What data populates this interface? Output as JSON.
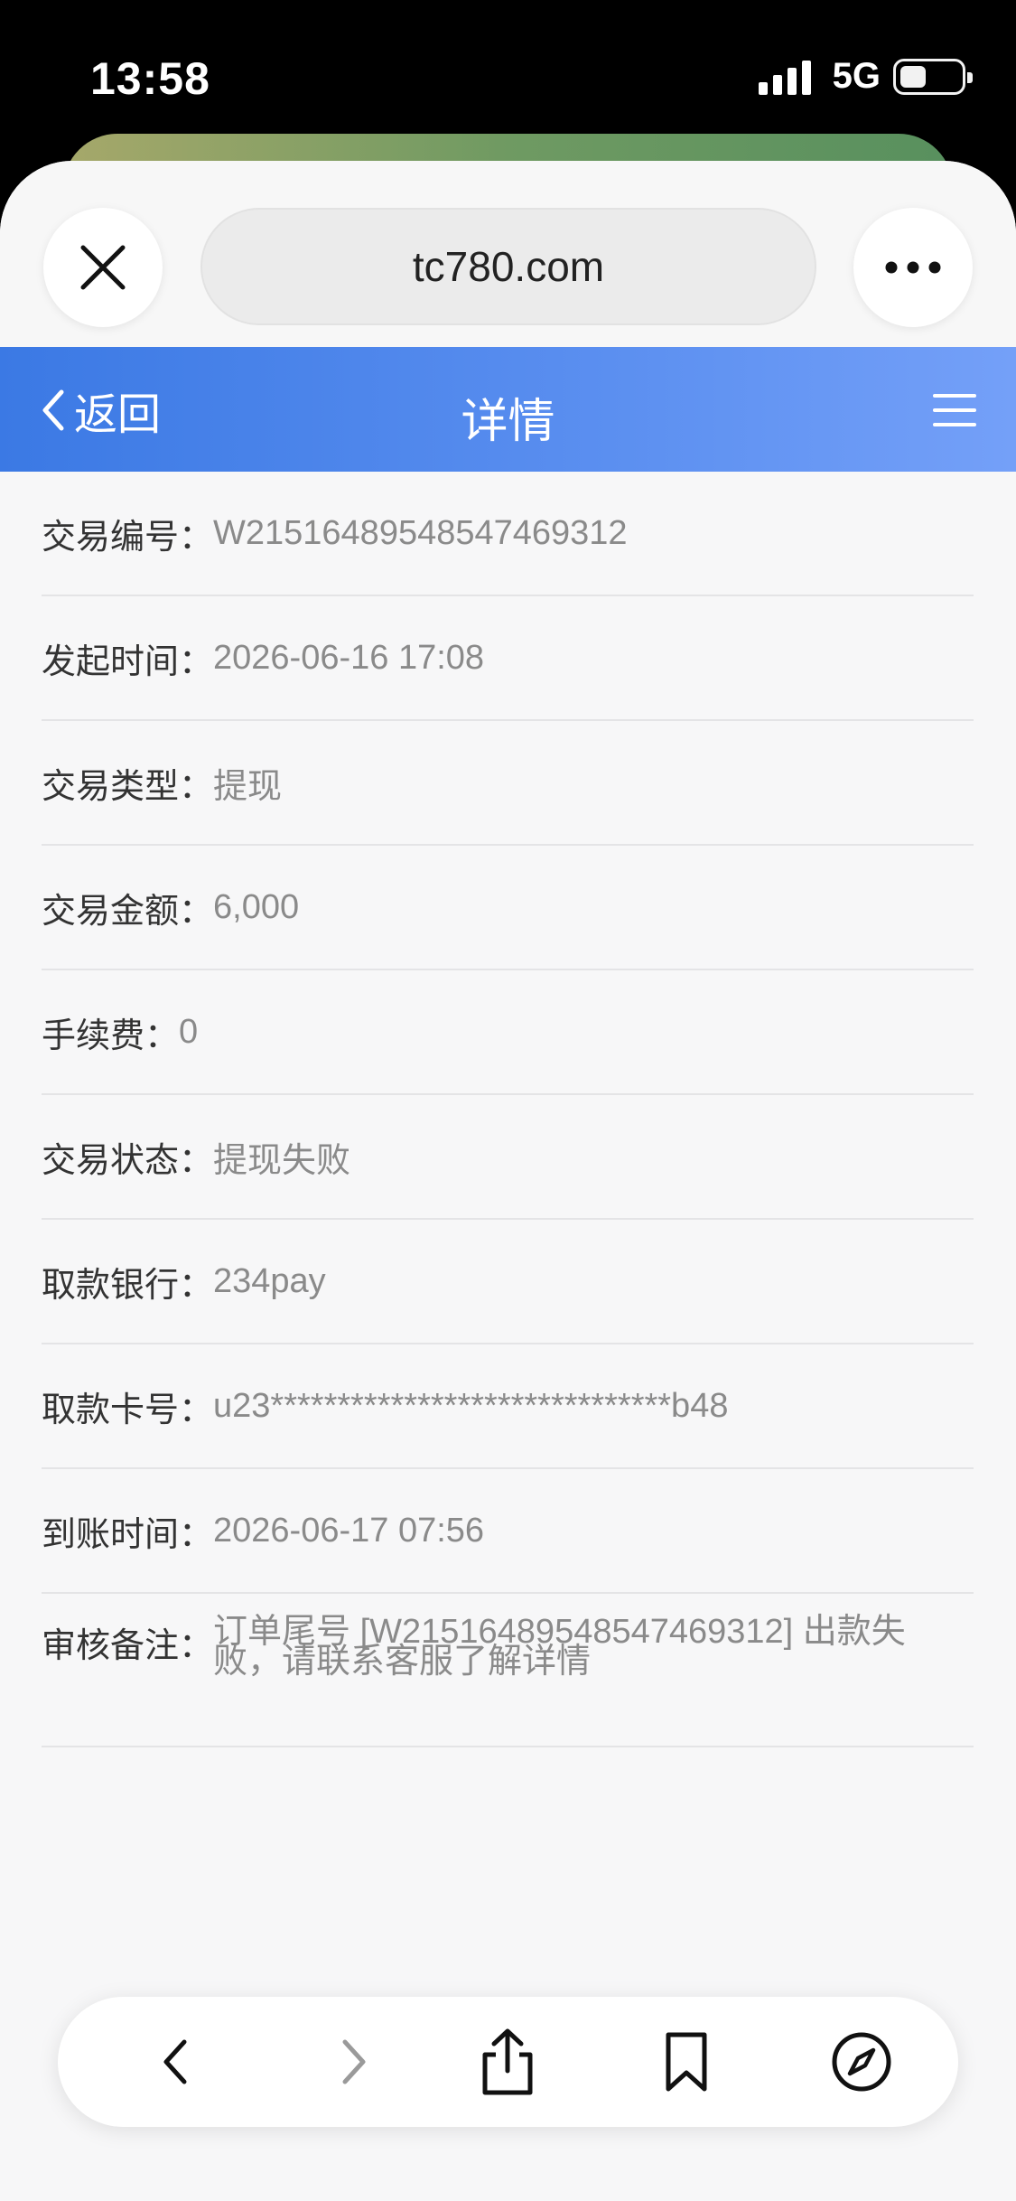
{
  "status_bar": {
    "time": "13:58",
    "network": "5G",
    "signal_bars": 4,
    "battery_level": 0.4
  },
  "browser": {
    "url": "tc780.com",
    "close_icon": "close-icon",
    "more_icon": "more-horizontal-icon"
  },
  "nav": {
    "back_label": "返回",
    "title": "详情",
    "menu_icon": "hamburger-menu-icon",
    "gradient_start": "#3b79e4",
    "gradient_end": "#74a0f8"
  },
  "details": [
    {
      "label": "交易编号：",
      "value": "W215164895485474693​12"
    },
    {
      "label": "发起时间：",
      "value": "2026-06-16 17:08"
    },
    {
      "label": "交易类型：",
      "value": "提现"
    },
    {
      "label": "交易金额：",
      "value": "6,000"
    },
    {
      "label": "手续费：",
      "value": "0"
    },
    {
      "label": "交易状态：",
      "value": "提现失败"
    },
    {
      "label": "取款银行：",
      "value": "234pay"
    },
    {
      "label": "取款卡号：",
      "value": "u23******************************b48"
    },
    {
      "label": "到账时间：",
      "value": "2026-06-17 07:56"
    },
    {
      "label": "审核备注：",
      "value": "订单尾号 [W21516489548547469312] 出款失败，请联系客服了解详情"
    }
  ],
  "toolbar": {
    "back_icon": "chevron-left-icon",
    "forward_icon": "chevron-right-icon",
    "share_icon": "share-icon",
    "bookmarks_icon": "bookmark-icon",
    "compass_icon": "compass-icon"
  }
}
